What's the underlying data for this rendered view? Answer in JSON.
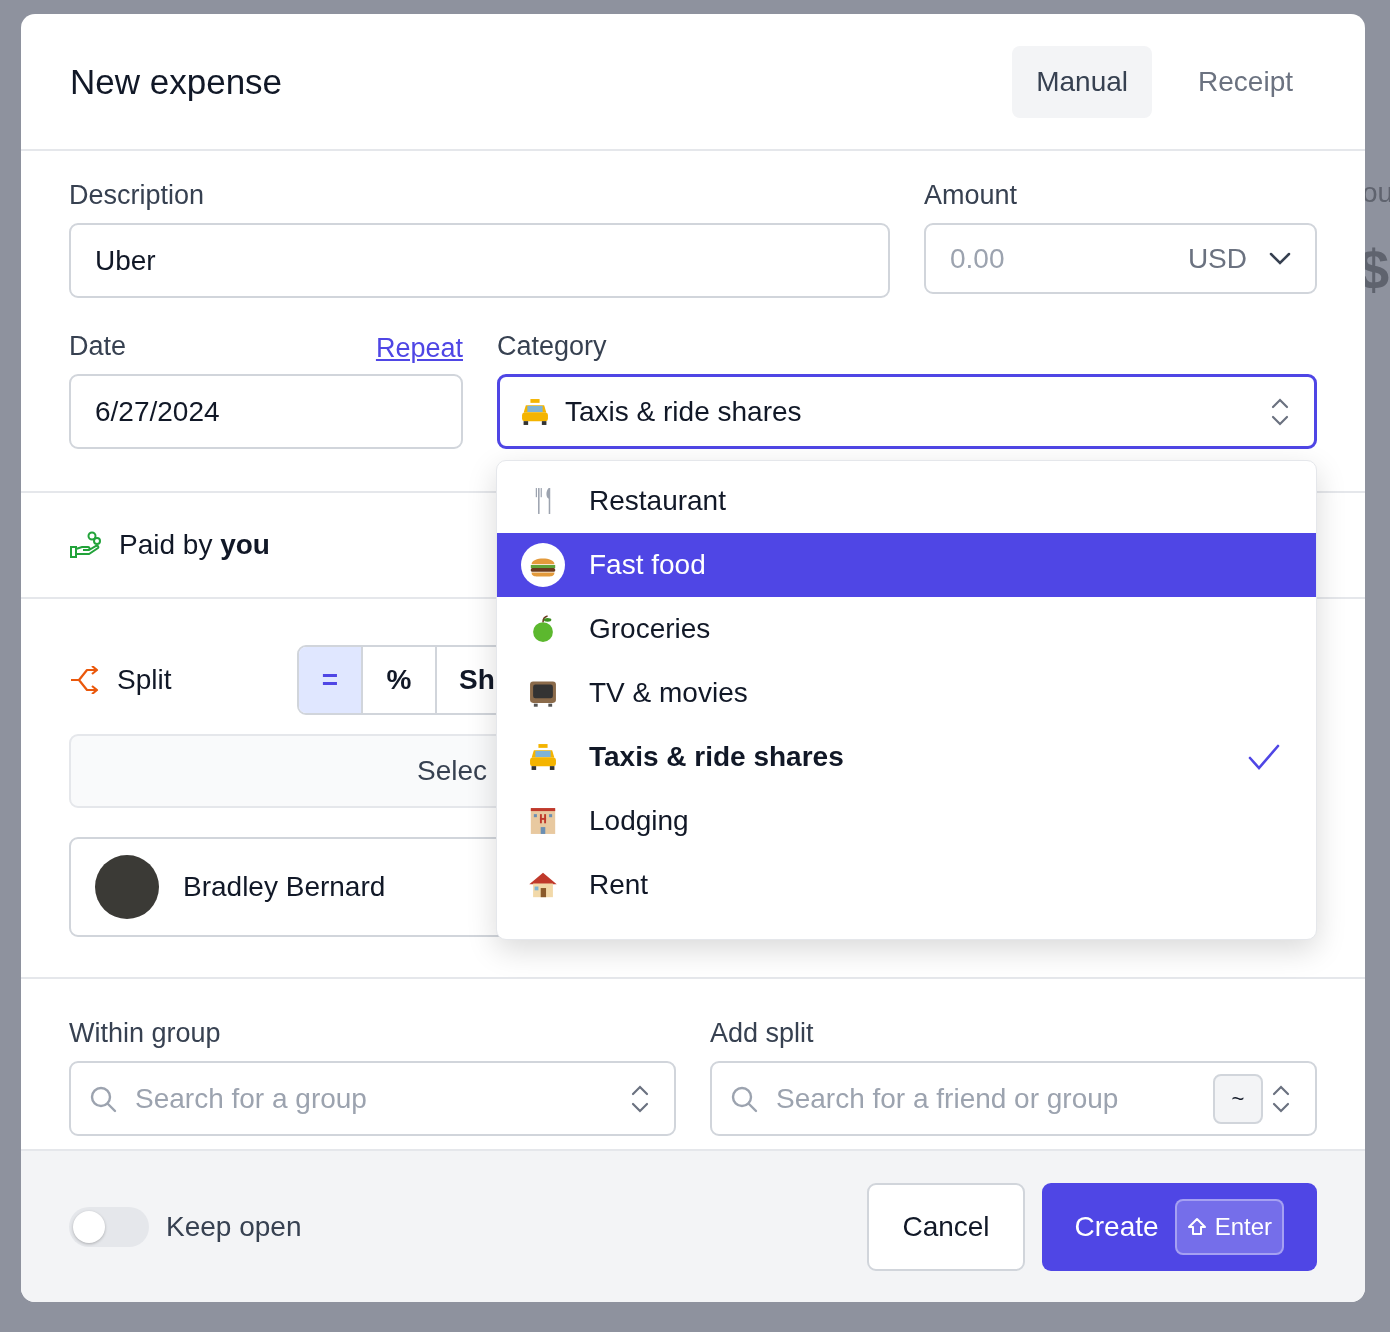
{
  "dialog": {
    "title": "New expense",
    "tabs": [
      {
        "label": "Manual",
        "selected": true
      },
      {
        "label": "Receipt",
        "selected": false
      }
    ]
  },
  "description": {
    "label": "Description",
    "value": "Uber"
  },
  "amount": {
    "label": "Amount",
    "placeholder": "0.00",
    "currency": "USD"
  },
  "date": {
    "label": "Date",
    "link": "Repeat",
    "value": "6/27/2024"
  },
  "category": {
    "label": "Category",
    "value": "Taxis & ride shares",
    "focused": true
  },
  "category_menu": {
    "options": [
      {
        "label": "Restaurant",
        "highlighted": false,
        "selected": false
      },
      {
        "label": "Fast food",
        "highlighted": true,
        "selected": false
      },
      {
        "label": "Groceries",
        "highlighted": false,
        "selected": false
      },
      {
        "label": "TV & movies",
        "highlighted": false,
        "selected": false
      },
      {
        "label": "Taxis & ride shares",
        "highlighted": false,
        "selected": true
      },
      {
        "label": "Lodging",
        "highlighted": false,
        "selected": false
      },
      {
        "label": "Rent",
        "highlighted": false,
        "selected": false
      }
    ]
  },
  "paid_by": {
    "text": "Paid by **you**"
  },
  "split": {
    "label": "Split",
    "modes": [
      {
        "label": "=",
        "selected": true
      },
      {
        "label": "%",
        "selected": false
      },
      {
        "label": "Sh",
        "selected": false
      }
    ],
    "select_button": "Selec",
    "participants": [
      {
        "name": "Bradley Bernard"
      }
    ]
  },
  "within_group": {
    "label": "Within group",
    "placeholder": "Search for a group"
  },
  "add_split": {
    "label": "Add split",
    "placeholder": "Search for a friend or group",
    "key_hint": "~"
  },
  "footer": {
    "keep_open": {
      "label": "Keep open",
      "on": false
    },
    "buttons": [
      {
        "label": "Cancel",
        "kind": "secondary"
      },
      {
        "label": "Create",
        "kind": "primary",
        "shortcut": "Enter"
      }
    ]
  },
  "background": {
    "fragments": [
      "ou",
      "$"
    ]
  }
}
